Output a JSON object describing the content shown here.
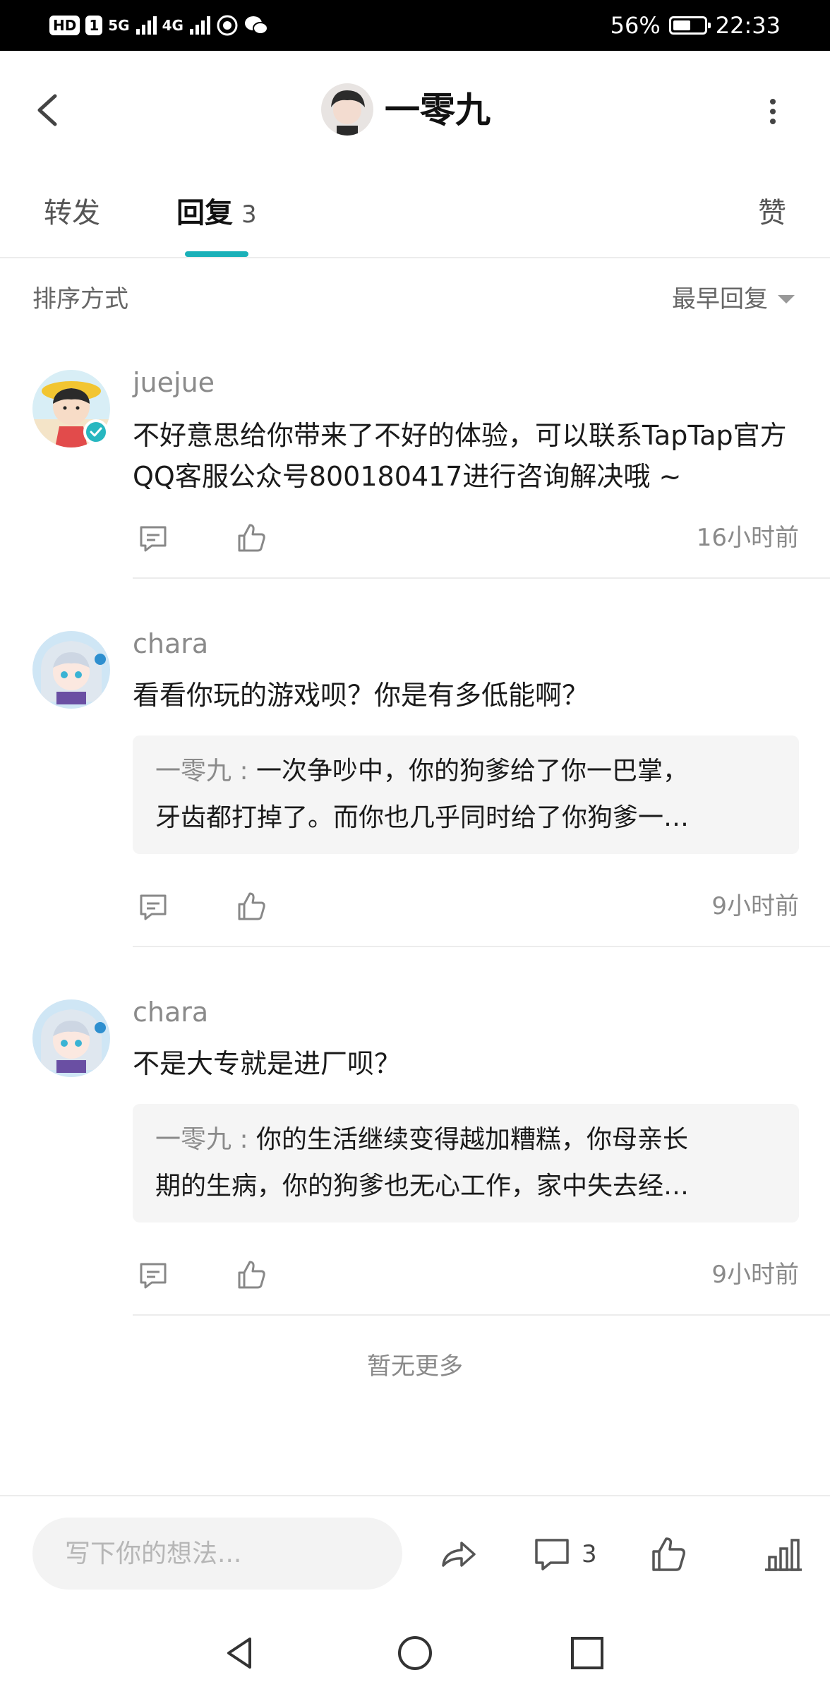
{
  "status_bar": {
    "hd_label": "HD",
    "sim_label": "1",
    "net1": "5G",
    "net2": "4G",
    "battery_percent": "56%",
    "battery_level": 0.56,
    "time": "22:33"
  },
  "header": {
    "title": "一零九",
    "back_icon": "chevron-left-icon",
    "more_icon": "more-vertical-icon"
  },
  "tabs": {
    "repost": "转发",
    "reply": "回复",
    "reply_count": "3",
    "like": "赞"
  },
  "sort": {
    "label": "排序方式",
    "value": "最早回复"
  },
  "comments": [
    {
      "user": "juejue",
      "verified": true,
      "text": "不好意思给你带来了不好的体验，可以联系TapTap官方QQ客服公众号800180417进行咨询解决哦 ~",
      "time": "16小时前"
    },
    {
      "user": "chara",
      "text": "看看你玩的游戏呗？你是有多低能啊？",
      "quote_author": "一零九",
      "quote_sep": " : ",
      "quote_line1": "一次争吵中，你的狗爹给了你一巴掌，",
      "quote_line2": "牙齿都打掉了。而你也几乎同时给了你狗爹一…",
      "time": "9小时前"
    },
    {
      "user": "chara",
      "text": "不是大专就是进厂呗？",
      "quote_author": "一零九",
      "quote_sep": " : ",
      "quote_line1": "你的生活继续变得越加糟糕，你母亲长",
      "quote_line2": "期的生病，你的狗爹也无心工作，家中失去经…",
      "time": "9小时前"
    }
  ],
  "no_more": "暂无更多",
  "bottom_bar": {
    "input_placeholder": "写下你的想法...",
    "comment_count": "3"
  },
  "colors": {
    "accent": "#1ab0b8",
    "verify_badge": "#27b7c0"
  }
}
